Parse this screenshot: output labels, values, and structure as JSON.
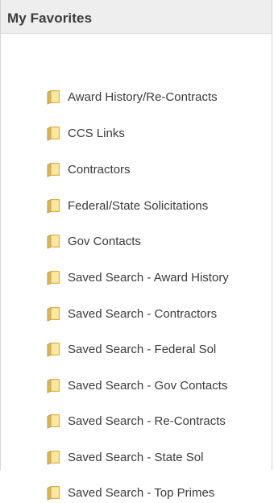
{
  "panel": {
    "title": "My Favorites"
  },
  "favorites": [
    {
      "label": "Award History/Re-Contracts",
      "icon": "folder-icon"
    },
    {
      "label": "CCS Links",
      "icon": "folder-icon"
    },
    {
      "label": "Contractors",
      "icon": "folder-icon"
    },
    {
      "label": "Federal/State Solicitations",
      "icon": "folder-icon"
    },
    {
      "label": "Gov Contacts",
      "icon": "folder-icon"
    },
    {
      "label": "Saved Search - Award History",
      "icon": "folder-icon"
    },
    {
      "label": "Saved Search - Contractors",
      "icon": "folder-icon"
    },
    {
      "label": "Saved Search - Federal Sol",
      "icon": "folder-icon"
    },
    {
      "label": "Saved Search - Gov Contacts",
      "icon": "folder-icon"
    },
    {
      "label": "Saved Search - Re-Contracts",
      "icon": "folder-icon"
    },
    {
      "label": "Saved Search - State Sol",
      "icon": "folder-icon"
    },
    {
      "label": "Saved Search - Top Primes",
      "icon": "folder-icon"
    }
  ],
  "colors": {
    "header_bg": "#eeeeee",
    "folder_fill": "#f5d67a",
    "folder_stroke": "#c9a23a"
  }
}
